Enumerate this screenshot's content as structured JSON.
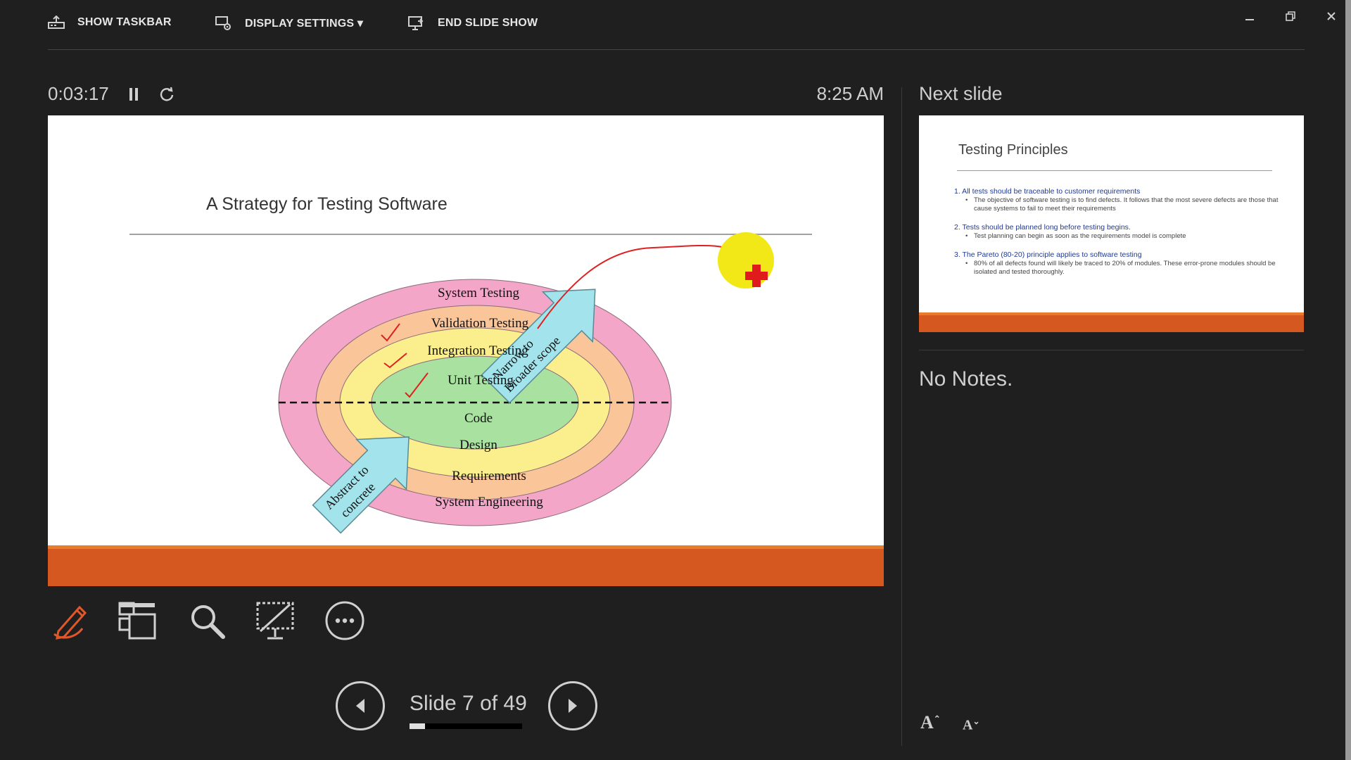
{
  "toolbar": {
    "show_taskbar": "SHOW TASKBAR",
    "display_settings": "DISPLAY SETTINGS ▾",
    "end_slide_show": "END SLIDE SHOW"
  },
  "timer": {
    "elapsed": "0:03:17",
    "clock": "8:25 AM"
  },
  "current_slide": {
    "title": "A Strategy for Testing Software",
    "diagram": {
      "rings": [
        "System Testing",
        "Validation Testing",
        "Integration Testing",
        "Unit Testing",
        "Code",
        "Design",
        "Requirements",
        "System Engineering"
      ],
      "arrow_up": [
        "Narrow to",
        "Broader scope"
      ],
      "arrow_down": [
        "Abstract to",
        "concrete"
      ]
    },
    "accent_color": "#d4581f"
  },
  "navigation": {
    "slide_counter": "Slide 7 of 49",
    "progress": 0.14
  },
  "next_slide": {
    "label": "Next slide",
    "title": "Testing Principles",
    "items": [
      {
        "heading": "1. All tests should be traceable to customer requirements",
        "detail": "The objective of software testing is to find defects. It follows that the most severe defects are those that cause systems to fail to meet their requirements"
      },
      {
        "heading": "2. Tests should be planned long before testing begins.",
        "detail": "Test planning can begin as soon as the requirements model is complete"
      },
      {
        "heading": "3. The Pareto (80-20) principle applies to software testing",
        "detail": "80% of all defects found will likely be traced to 20% of modules. These error-prone modules should be isolated and tested thoroughly."
      }
    ]
  },
  "notes": {
    "text": "No Notes."
  },
  "icons": [
    "taskbar-icon",
    "display-settings-icon",
    "end-show-icon",
    "minimize-icon",
    "restore-icon",
    "close-icon",
    "pause-icon",
    "restart-icon",
    "pen-icon",
    "grid-view-icon",
    "zoom-icon",
    "black-screen-icon",
    "more-options-icon",
    "previous-icon",
    "next-icon",
    "increase-font-icon",
    "decrease-font-icon"
  ],
  "font_buttons": {
    "increase": "A",
    "decrease": "A"
  }
}
